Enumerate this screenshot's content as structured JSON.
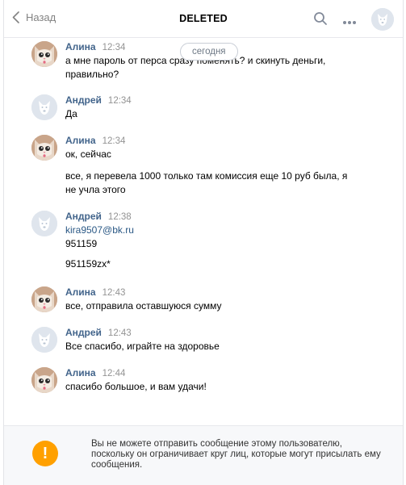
{
  "header": {
    "back_label": "Назад",
    "title": "DELETED"
  },
  "date_separator": "сегодня",
  "messages": [
    {
      "author": "Алина",
      "time": "12:34",
      "avatar": "cat-avatar",
      "lines": [
        "а мне пароль от перса сразу поменять? и скинуть деньги,",
        "правильно?"
      ]
    },
    {
      "author": "Андрей",
      "time": "12:34",
      "avatar": "dog-avatar",
      "lines": [
        "Да"
      ]
    },
    {
      "author": "Алина",
      "time": "12:34",
      "avatar": "cat-avatar",
      "lines": [
        "ок, сейчас"
      ],
      "lines2": [
        "все, я перевела 1000 только там комиссия еще 10 руб была, я",
        "не учла этого"
      ]
    },
    {
      "author": "Андрей",
      "time": "12:38",
      "avatar": "dog-avatar",
      "link": "kira9507@bk.ru",
      "lines": [
        "951159"
      ],
      "lines2": [
        "951159zx*"
      ]
    },
    {
      "author": "Алина",
      "time": "12:43",
      "avatar": "cat-avatar",
      "lines": [
        "все, отправила оставшуюся сумму"
      ]
    },
    {
      "author": "Андрей",
      "time": "12:43",
      "avatar": "dog-avatar",
      "lines": [
        "Все спасибо, играйте на здоровье"
      ]
    },
    {
      "author": "Алина",
      "time": "12:44",
      "avatar": "cat-avatar",
      "lines": [
        "спасибо большое, и вам удачи!"
      ]
    }
  ],
  "notice": {
    "icon": "!",
    "text": "Вы не можете отправить сообщение этому пользователю, поскольку он ограничивает круг лиц, которые могут присылать ему сообщения."
  },
  "colors": {
    "author_name": "#42648b",
    "link": "#2a5885",
    "warning": "#ffa000"
  }
}
